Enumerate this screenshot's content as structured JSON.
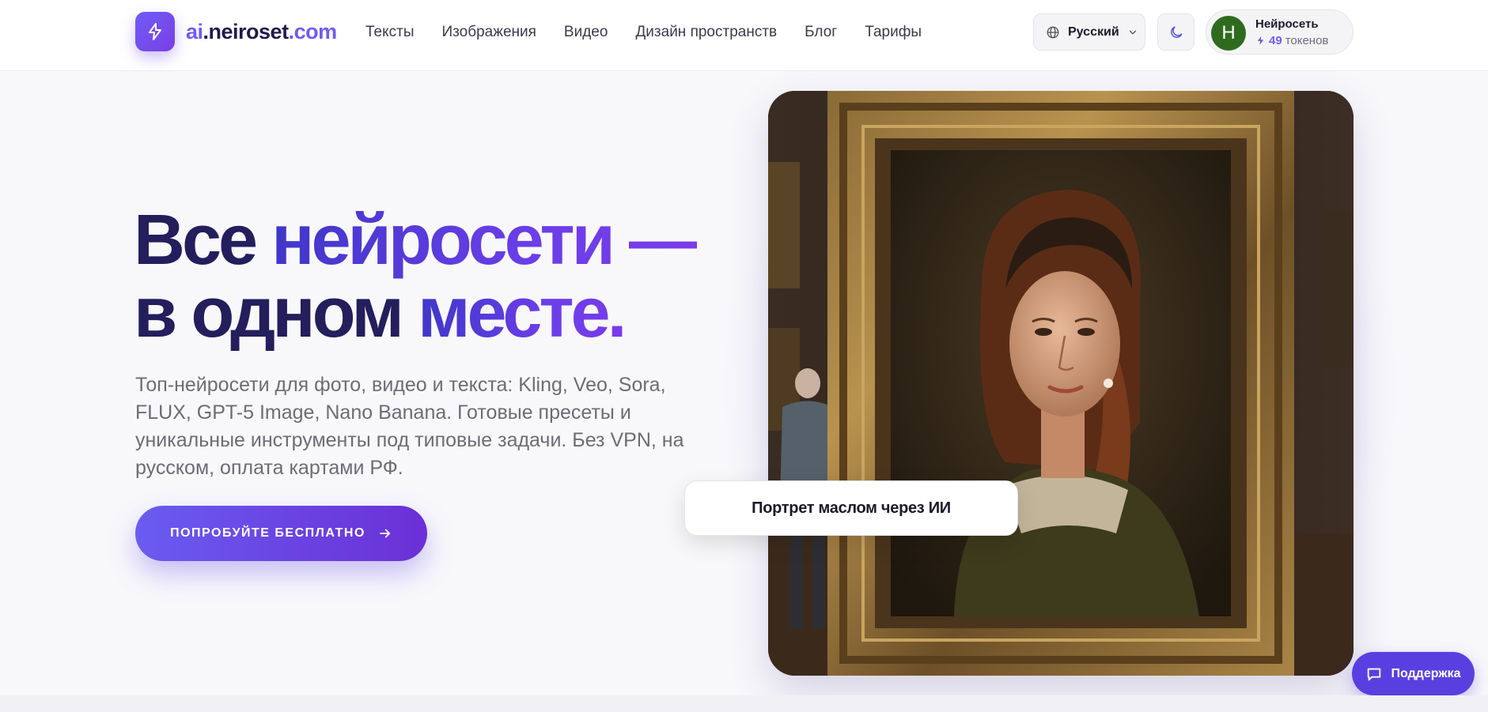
{
  "brand": {
    "logo_prefix": "ai",
    "logo_main": ".neiroset",
    "logo_tld": ".com",
    "accent_color": "#6d5cf6",
    "logo_icon": "lightning-icon"
  },
  "nav": {
    "items": [
      {
        "label": "Тексты"
      },
      {
        "label": "Изображения"
      },
      {
        "label": "Видео"
      },
      {
        "label": "Дизайн пространств"
      },
      {
        "label": "Блог"
      },
      {
        "label": "Тарифы"
      }
    ]
  },
  "header": {
    "language": {
      "label": "Русский",
      "icon": "globe-icon",
      "chevron": "chevron-down-icon"
    },
    "theme_toggle": {
      "icon": "moon-icon"
    },
    "user": {
      "avatar_letter": "Н",
      "name": "Нейросеть",
      "token_count": "49",
      "token_label": "токенов",
      "token_icon": "lightning-icon"
    }
  },
  "hero": {
    "title_line1_dark": "Все ",
    "title_line1_accent": "нейросети —",
    "title_line2_dark": "в одном ",
    "title_line2_accent": "месте.",
    "description": "Топ-нейросети для фото, видео и текста: Kling, Veo, Sora, FLUX, GPT-5 Image, Nano Banana. Готовые пресеты и уникальные инструменты под типовые задачи. Без VPN, на русском, оплата картами РФ.",
    "cta_label": "ПОПРОБУЙТЕ БЕСПЛАТНО",
    "cta_icon": "arrow-right-icon",
    "image_caption": "Портрет маслом через ИИ"
  },
  "support": {
    "label": "Поддержка",
    "icon": "chat-icon"
  }
}
